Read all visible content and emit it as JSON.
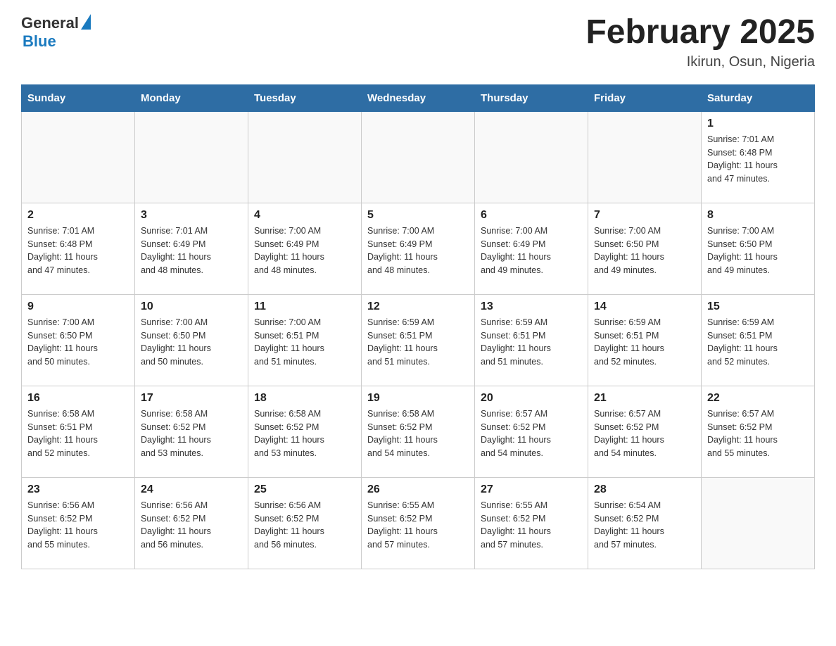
{
  "header": {
    "logo_general": "General",
    "logo_blue": "Blue",
    "title": "February 2025",
    "subtitle": "Ikirun, Osun, Nigeria"
  },
  "weekdays": [
    "Sunday",
    "Monday",
    "Tuesday",
    "Wednesday",
    "Thursday",
    "Friday",
    "Saturday"
  ],
  "weeks": [
    [
      {
        "day": "",
        "info": ""
      },
      {
        "day": "",
        "info": ""
      },
      {
        "day": "",
        "info": ""
      },
      {
        "day": "",
        "info": ""
      },
      {
        "day": "",
        "info": ""
      },
      {
        "day": "",
        "info": ""
      },
      {
        "day": "1",
        "info": "Sunrise: 7:01 AM\nSunset: 6:48 PM\nDaylight: 11 hours\nand 47 minutes."
      }
    ],
    [
      {
        "day": "2",
        "info": "Sunrise: 7:01 AM\nSunset: 6:48 PM\nDaylight: 11 hours\nand 47 minutes."
      },
      {
        "day": "3",
        "info": "Sunrise: 7:01 AM\nSunset: 6:49 PM\nDaylight: 11 hours\nand 48 minutes."
      },
      {
        "day": "4",
        "info": "Sunrise: 7:00 AM\nSunset: 6:49 PM\nDaylight: 11 hours\nand 48 minutes."
      },
      {
        "day": "5",
        "info": "Sunrise: 7:00 AM\nSunset: 6:49 PM\nDaylight: 11 hours\nand 48 minutes."
      },
      {
        "day": "6",
        "info": "Sunrise: 7:00 AM\nSunset: 6:49 PM\nDaylight: 11 hours\nand 49 minutes."
      },
      {
        "day": "7",
        "info": "Sunrise: 7:00 AM\nSunset: 6:50 PM\nDaylight: 11 hours\nand 49 minutes."
      },
      {
        "day": "8",
        "info": "Sunrise: 7:00 AM\nSunset: 6:50 PM\nDaylight: 11 hours\nand 49 minutes."
      }
    ],
    [
      {
        "day": "9",
        "info": "Sunrise: 7:00 AM\nSunset: 6:50 PM\nDaylight: 11 hours\nand 50 minutes."
      },
      {
        "day": "10",
        "info": "Sunrise: 7:00 AM\nSunset: 6:50 PM\nDaylight: 11 hours\nand 50 minutes."
      },
      {
        "day": "11",
        "info": "Sunrise: 7:00 AM\nSunset: 6:51 PM\nDaylight: 11 hours\nand 51 minutes."
      },
      {
        "day": "12",
        "info": "Sunrise: 6:59 AM\nSunset: 6:51 PM\nDaylight: 11 hours\nand 51 minutes."
      },
      {
        "day": "13",
        "info": "Sunrise: 6:59 AM\nSunset: 6:51 PM\nDaylight: 11 hours\nand 51 minutes."
      },
      {
        "day": "14",
        "info": "Sunrise: 6:59 AM\nSunset: 6:51 PM\nDaylight: 11 hours\nand 52 minutes."
      },
      {
        "day": "15",
        "info": "Sunrise: 6:59 AM\nSunset: 6:51 PM\nDaylight: 11 hours\nand 52 minutes."
      }
    ],
    [
      {
        "day": "16",
        "info": "Sunrise: 6:58 AM\nSunset: 6:51 PM\nDaylight: 11 hours\nand 52 minutes."
      },
      {
        "day": "17",
        "info": "Sunrise: 6:58 AM\nSunset: 6:52 PM\nDaylight: 11 hours\nand 53 minutes."
      },
      {
        "day": "18",
        "info": "Sunrise: 6:58 AM\nSunset: 6:52 PM\nDaylight: 11 hours\nand 53 minutes."
      },
      {
        "day": "19",
        "info": "Sunrise: 6:58 AM\nSunset: 6:52 PM\nDaylight: 11 hours\nand 54 minutes."
      },
      {
        "day": "20",
        "info": "Sunrise: 6:57 AM\nSunset: 6:52 PM\nDaylight: 11 hours\nand 54 minutes."
      },
      {
        "day": "21",
        "info": "Sunrise: 6:57 AM\nSunset: 6:52 PM\nDaylight: 11 hours\nand 54 minutes."
      },
      {
        "day": "22",
        "info": "Sunrise: 6:57 AM\nSunset: 6:52 PM\nDaylight: 11 hours\nand 55 minutes."
      }
    ],
    [
      {
        "day": "23",
        "info": "Sunrise: 6:56 AM\nSunset: 6:52 PM\nDaylight: 11 hours\nand 55 minutes."
      },
      {
        "day": "24",
        "info": "Sunrise: 6:56 AM\nSunset: 6:52 PM\nDaylight: 11 hours\nand 56 minutes."
      },
      {
        "day": "25",
        "info": "Sunrise: 6:56 AM\nSunset: 6:52 PM\nDaylight: 11 hours\nand 56 minutes."
      },
      {
        "day": "26",
        "info": "Sunrise: 6:55 AM\nSunset: 6:52 PM\nDaylight: 11 hours\nand 57 minutes."
      },
      {
        "day": "27",
        "info": "Sunrise: 6:55 AM\nSunset: 6:52 PM\nDaylight: 11 hours\nand 57 minutes."
      },
      {
        "day": "28",
        "info": "Sunrise: 6:54 AM\nSunset: 6:52 PM\nDaylight: 11 hours\nand 57 minutes."
      },
      {
        "day": "",
        "info": ""
      }
    ]
  ]
}
